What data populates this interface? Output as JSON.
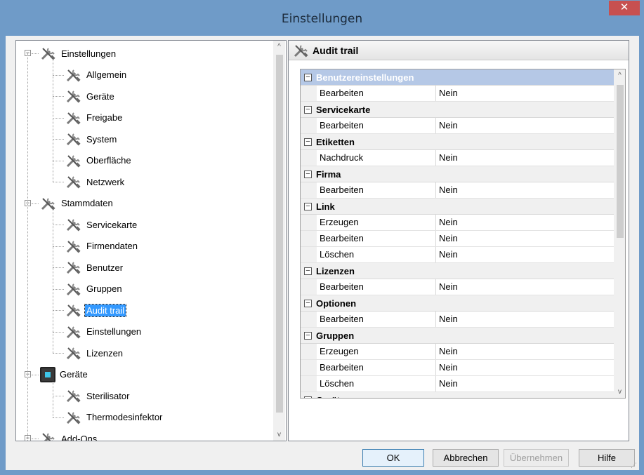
{
  "window": {
    "title": "Einstellungen",
    "close_glyph": "✕"
  },
  "tree": {
    "items": [
      {
        "label": "Einstellungen",
        "level": 0,
        "icon": "tools-icon",
        "expander": "−",
        "selected": false
      },
      {
        "label": "Allgemein",
        "level": 1,
        "icon": "tools-icon",
        "selected": false
      },
      {
        "label": "Geräte",
        "level": 1,
        "icon": "tools-icon",
        "selected": false
      },
      {
        "label": "Freigabe",
        "level": 1,
        "icon": "tools-icon",
        "selected": false
      },
      {
        "label": "System",
        "level": 1,
        "icon": "tools-icon",
        "selected": false
      },
      {
        "label": "Oberfläche",
        "level": 1,
        "icon": "tools-icon",
        "selected": false
      },
      {
        "label": "Netzwerk",
        "level": 1,
        "icon": "tools-icon",
        "selected": false
      },
      {
        "label": "Stammdaten",
        "level": 0,
        "icon": "tools-icon",
        "expander": "−",
        "selected": false
      },
      {
        "label": "Servicekarte",
        "level": 1,
        "icon": "tools-icon",
        "selected": false
      },
      {
        "label": "Firmendaten",
        "level": 1,
        "icon": "tools-icon",
        "selected": false
      },
      {
        "label": "Benutzer",
        "level": 1,
        "icon": "tools-icon",
        "selected": false
      },
      {
        "label": "Gruppen",
        "level": 1,
        "icon": "tools-icon",
        "selected": false
      },
      {
        "label": "Audit trail",
        "level": 1,
        "icon": "tools-icon",
        "selected": true
      },
      {
        "label": "Einstellungen",
        "level": 1,
        "icon": "tools-icon",
        "selected": false
      },
      {
        "label": "Lizenzen",
        "level": 1,
        "icon": "tools-icon",
        "selected": false
      },
      {
        "label": "Geräte",
        "level": 0,
        "icon": "device-icon",
        "expander": "−",
        "selected": false
      },
      {
        "label": "Sterilisator",
        "level": 1,
        "icon": "tools-icon",
        "selected": false
      },
      {
        "label": "Thermodesinfektor",
        "level": 1,
        "icon": "tools-icon",
        "selected": false
      },
      {
        "label": "Add-Ons",
        "level": 0,
        "icon": "tools-icon",
        "expander": "−",
        "selected": false
      }
    ]
  },
  "panel": {
    "title": "Audit trail",
    "groups": [
      {
        "name": "Benutzereinstellungen",
        "active": true,
        "rows": [
          {
            "name": "Bearbeiten",
            "value": "Nein"
          }
        ]
      },
      {
        "name": "Servicekarte",
        "active": false,
        "rows": [
          {
            "name": "Bearbeiten",
            "value": "Nein"
          }
        ]
      },
      {
        "name": "Etiketten",
        "active": false,
        "rows": [
          {
            "name": "Nachdruck",
            "value": "Nein"
          }
        ]
      },
      {
        "name": "Firma",
        "active": false,
        "rows": [
          {
            "name": "Bearbeiten",
            "value": "Nein"
          }
        ]
      },
      {
        "name": "Link",
        "active": false,
        "rows": [
          {
            "name": "Erzeugen",
            "value": "Nein"
          },
          {
            "name": "Bearbeiten",
            "value": "Nein"
          },
          {
            "name": "Löschen",
            "value": "Nein"
          }
        ]
      },
      {
        "name": "Lizenzen",
        "active": false,
        "rows": [
          {
            "name": "Bearbeiten",
            "value": "Nein"
          }
        ]
      },
      {
        "name": "Optionen",
        "active": false,
        "rows": [
          {
            "name": "Bearbeiten",
            "value": "Nein"
          }
        ]
      },
      {
        "name": "Gruppen",
        "active": false,
        "rows": [
          {
            "name": "Erzeugen",
            "value": "Nein"
          },
          {
            "name": "Bearbeiten",
            "value": "Nein"
          },
          {
            "name": "Löschen",
            "value": "Nein"
          }
        ]
      },
      {
        "name": "Geräte",
        "active": false,
        "rows": []
      }
    ]
  },
  "buttons": {
    "ok": "OK",
    "cancel": "Abbrechen",
    "apply": "Übernehmen",
    "help": "Hilfe"
  },
  "scroll": {
    "up": "^",
    "down": "v"
  },
  "colors": {
    "title_bar": "#6f9bc8",
    "selection": "#3399ff",
    "close": "#c75050",
    "active_category": "#b5c8e6"
  }
}
